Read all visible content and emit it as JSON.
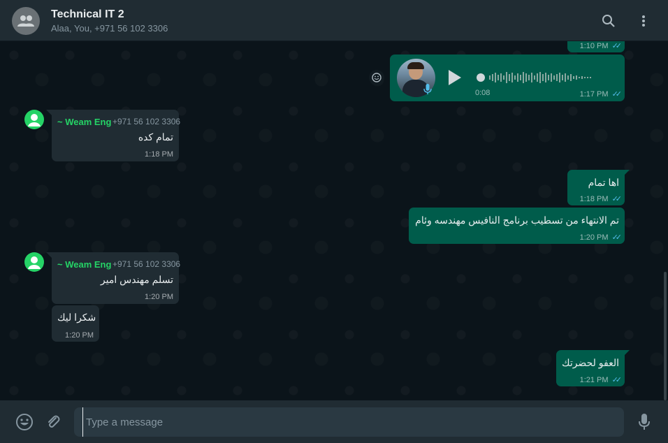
{
  "header": {
    "title": "Technical IT 2",
    "subtitle": "Alaa, You, +971 56 102 3306"
  },
  "messages": {
    "m0": {
      "time": "1:10 PM"
    },
    "voice": {
      "duration": "0:08",
      "time": "1:17 PM"
    },
    "m1": {
      "sender": "~ Weam Eng",
      "phone": "+971 56 102 3306",
      "text": "تمام كده",
      "time": "1:18 PM"
    },
    "m2": {
      "text": "اها تمام",
      "time": "1:18 PM"
    },
    "m3": {
      "text": "تم الانتهاء من تسطيب برنامج النافيس مهندسه وئام",
      "time": "1:20 PM"
    },
    "m4": {
      "sender": "~ Weam Eng",
      "phone": "+971 56 102 3306",
      "text": "تسلم مهندس امير",
      "time": "1:20 PM"
    },
    "m5": {
      "text": "شكرا ليك",
      "time": "1:20 PM"
    },
    "m6": {
      "text": "العفو لحضرتك",
      "time": "1:21 PM"
    }
  },
  "composer": {
    "placeholder": "Type a message"
  },
  "colors": {
    "outgoing": "#005c4b",
    "incoming": "#202c33",
    "accent": "#25d366",
    "read_ticks": "#53bdeb"
  },
  "icons": [
    "group-avatar-icon",
    "search-icon",
    "menu-icon",
    "emoji-icon",
    "attach-icon",
    "mic-icon",
    "play-icon",
    "check-double-icon"
  ]
}
